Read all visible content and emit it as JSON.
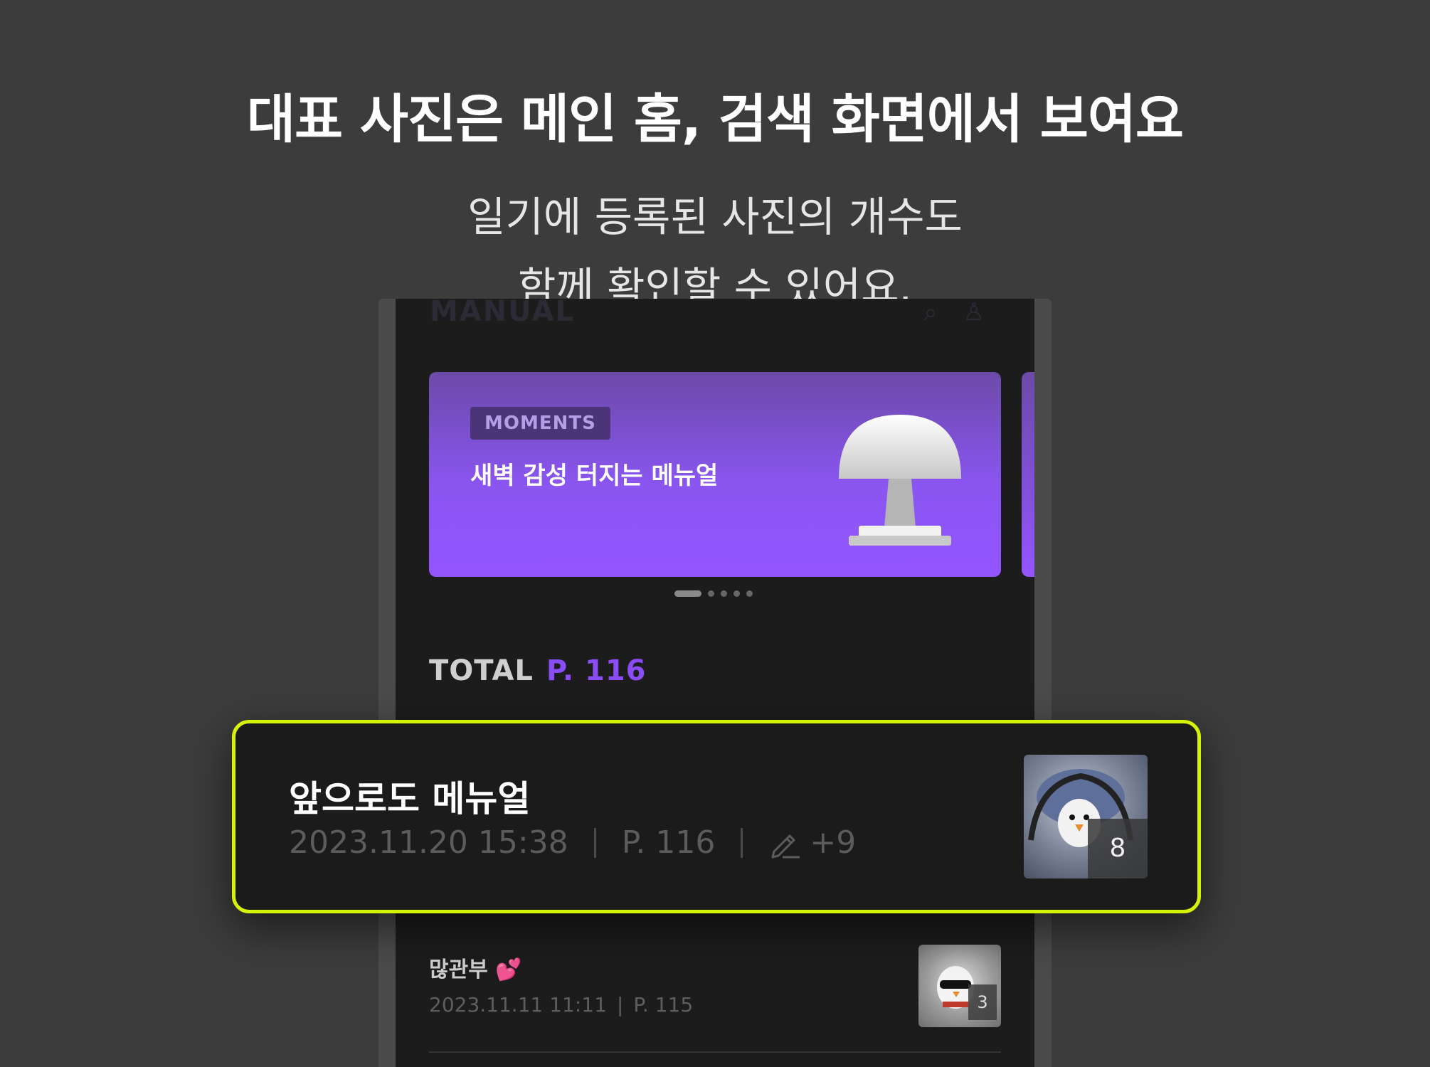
{
  "headline": "대표 사진은 메인 홈, 검색 화면에서 보여요",
  "subline": [
    "일기에 등록된 사진의 개수도",
    "함께 확인할 수 있어요."
  ],
  "app": {
    "logo": "MANUAL"
  },
  "banner": {
    "badge": "MOMENTS",
    "title": "새벽 감성 터지는 메뉴얼",
    "pagination": {
      "total": 5,
      "active": 1
    }
  },
  "total": {
    "label": "TOTAL",
    "page": "P. 116"
  },
  "highlighted_entry": {
    "title": "앞으로도 메뉴얼",
    "date": "2023.11.20 15:38",
    "page": "P. 116",
    "edits": "+9",
    "photo_count": "8"
  },
  "entries": [
    {
      "title": "많관부 💕",
      "date": "2023.11.11 11:11",
      "page": "P. 115",
      "photo_count": "3"
    }
  ],
  "colors": {
    "accent": "#8a4cf5",
    "highlight_border": "#d6f20a",
    "background": "#3c3c3c"
  }
}
